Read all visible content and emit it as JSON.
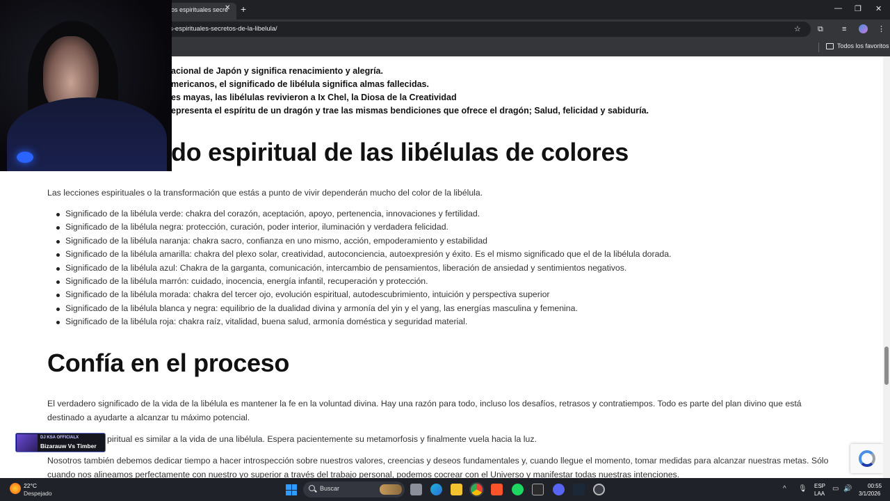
{
  "browser": {
    "tab_title": "os espirituales secre",
    "url": "s-espirituales-secretos-de-la-libelula/",
    "bookmarks_label": "Todos los favoritos"
  },
  "article": {
    "bold_lines": [
      "acional de Japón y significa renacimiento y alegría.",
      "mericanos, el significado de libélula significa almas fallecidas.",
      "es mayas, las libélulas revivieron a Ix Chel, la Diosa de la Creatividad",
      "epresenta el espíritu de un dragón y trae las mismas bendiciones que ofrece el dragón; Salud, felicidad y sabiduría."
    ],
    "heading_colors": "do espiritual de las libélulas de colores",
    "intro": "Las lecciones espirituales o la transformación que estás a punto de vivir dependerán mucho del color de la libélula.",
    "color_items": [
      "Significado de la libélula verde: chakra del corazón, aceptación, apoyo, pertenencia, innovaciones y fertilidad.",
      "Significado de la libélula negra: protección, curación, poder interior, iluminación y verdadera felicidad.",
      "Significado de la libélula naranja: chakra sacro, confianza en uno mismo, acción, empoderamiento y estabilidad",
      "Significado de la libélula amarilla: chakra del plexo solar, creatividad, autoconciencia, autoexpresión y éxito. Es el mismo significado que el de la libélula dorada.",
      "Significado de la libélula azul: Chakra de la garganta, comunicación, intercambio de pensamientos, liberación de ansiedad y sentimientos negativos.",
      "Significado de la libélula marrón: cuidado, inocencia, energía infantil, recuperación y protección.",
      "Significado de la libélula morada: chakra del tercer ojo, evolución espiritual, autodescubrimiento, intuición y perspectiva superior",
      "Significado de la libélula blanca y negra: equilibrio de la dualidad divina y armonía del yin y el yang, las energías masculina y femenina.",
      "Significado de la libélula roja: chakra raíz, vitalidad, buena salud, armonía doméstica y seguridad material."
    ],
    "heading_process": "Confía en el proceso",
    "para1": "El verdadero significado de la vida de la libélula es mantener la fe en la voluntad divina. Hay una razón para todo, incluso los desafíos, retrasos y contratiempos. Todo es parte del plan divino que está destinado a ayudarte a alcanzar tu máximo potencial.",
    "para2": "piritual es similar a la vida de una libélula. Espera pacientemente su metamorfosis y finalmente vuela hacia la luz.",
    "para3": "Nosotros también debemos dedicar tiempo a hacer introspección sobre nuestros valores, creencias y deseos fundamentales y, cuando llegue el momento, tomar medidas para alcanzar nuestras metas. Sólo cuando nos alineamos perfectamente con nuestro yo superior a través del trabajo personal, podemos cocrear con el Universo y manifestar todas nuestras intenciones."
  },
  "music_widget": {
    "artist": "DJ KSA OFFICIALX",
    "track": "Bizarauw Vs Timber"
  },
  "taskbar": {
    "temperature": "22°C",
    "condition": "Despejado",
    "search_label": "Buscar",
    "lang_line1": "ESP",
    "lang_line2": "LAA",
    "time": "00:55",
    "date": "3/1/2026"
  }
}
